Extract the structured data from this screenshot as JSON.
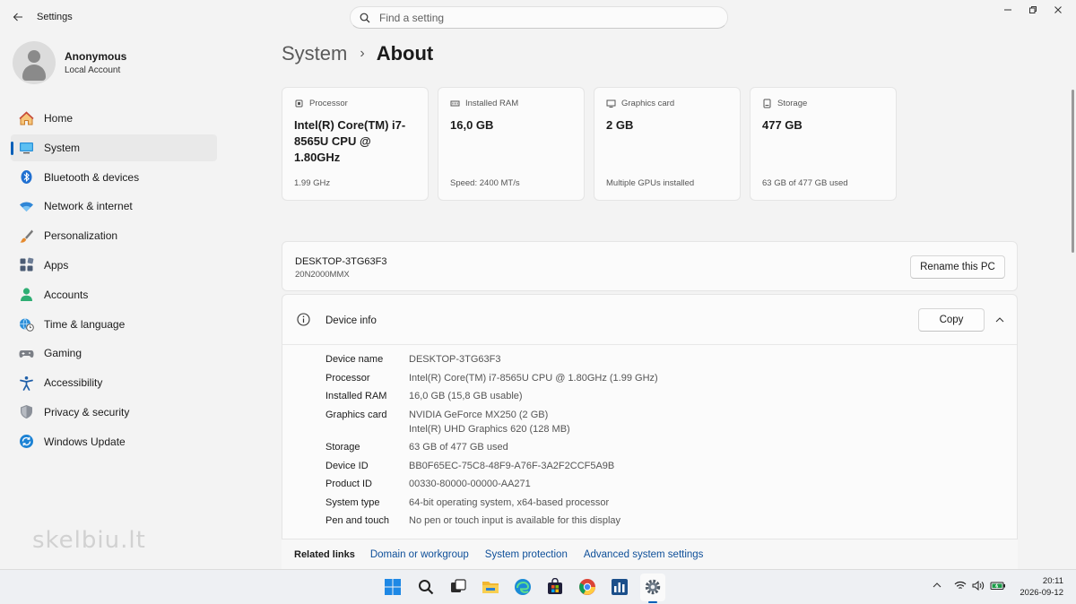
{
  "window": {
    "title": "Settings"
  },
  "search": {
    "placeholder": "Find a setting"
  },
  "profile": {
    "name": "Anonymous",
    "account_type": "Local Account"
  },
  "sidebar": {
    "items": [
      {
        "label": "Home",
        "icon": "home-icon"
      },
      {
        "label": "System",
        "icon": "system-icon",
        "active": true
      },
      {
        "label": "Bluetooth & devices",
        "icon": "bluetooth-icon"
      },
      {
        "label": "Network & internet",
        "icon": "wifi-icon"
      },
      {
        "label": "Personalization",
        "icon": "brush-icon"
      },
      {
        "label": "Apps",
        "icon": "apps-icon"
      },
      {
        "label": "Accounts",
        "icon": "person-icon"
      },
      {
        "label": "Time & language",
        "icon": "globe-clock-icon"
      },
      {
        "label": "Gaming",
        "icon": "gamepad-icon"
      },
      {
        "label": "Accessibility",
        "icon": "accessibility-icon"
      },
      {
        "label": "Privacy & security",
        "icon": "shield-icon"
      },
      {
        "label": "Windows Update",
        "icon": "update-icon"
      }
    ]
  },
  "breadcrumb": {
    "parent": "System",
    "separator": "›",
    "current": "About"
  },
  "specs": [
    {
      "label": "Processor",
      "value": "Intel(R) Core(TM) i7-8565U CPU @ 1.80GHz",
      "footer": "1.99 GHz",
      "icon": "processor-icon"
    },
    {
      "label": "Installed RAM",
      "value": "16,0 GB",
      "footer": "Speed: 2400 MT/s",
      "icon": "ram-icon"
    },
    {
      "label": "Graphics card",
      "value": "2 GB",
      "footer": "Multiple GPUs installed",
      "icon": "gpu-icon"
    },
    {
      "label": "Storage",
      "value": "477 GB",
      "footer": "63 GB of 477 GB used",
      "icon": "storage-icon"
    }
  ],
  "pc": {
    "name": "DESKTOP-3TG63F3",
    "model": "20N2000MMX",
    "rename_label": "Rename this PC"
  },
  "device_info": {
    "title": "Device info",
    "copy_label": "Copy",
    "rows": [
      {
        "label": "Device name",
        "value": "DESKTOP-3TG63F3"
      },
      {
        "label": "Processor",
        "value": "Intel(R) Core(TM) i7-8565U CPU @ 1.80GHz (1.99 GHz)"
      },
      {
        "label": "Installed RAM",
        "value": "16,0 GB (15,8 GB usable)"
      },
      {
        "label": "Graphics card",
        "value": "NVIDIA GeForce MX250 (2 GB)",
        "value2": "Intel(R) UHD Graphics 620 (128 MB)"
      },
      {
        "label": "Storage",
        "value": "63 GB of 477 GB used"
      },
      {
        "label": "Device ID",
        "value": "BB0F65EC-75C8-48F9-A76F-3A2F2CCF5A9B"
      },
      {
        "label": "Product ID",
        "value": "00330-80000-00000-AA271"
      },
      {
        "label": "System type",
        "value": "64-bit operating system, x64-based processor"
      },
      {
        "label": "Pen and touch",
        "value": "No pen or touch input is available for this display"
      }
    ]
  },
  "related": {
    "title": "Related links",
    "links": [
      "Domain or workgroup",
      "System protection",
      "Advanced system settings"
    ]
  },
  "watermark": "skelbiu.lt",
  "taskbar": {
    "time": "20:11",
    "date": "2026-09-12"
  },
  "colors": {
    "accent": "#005fb8",
    "link": "#0e4f99",
    "background": "#f3f3f3",
    "card": "#fbfbfb"
  }
}
